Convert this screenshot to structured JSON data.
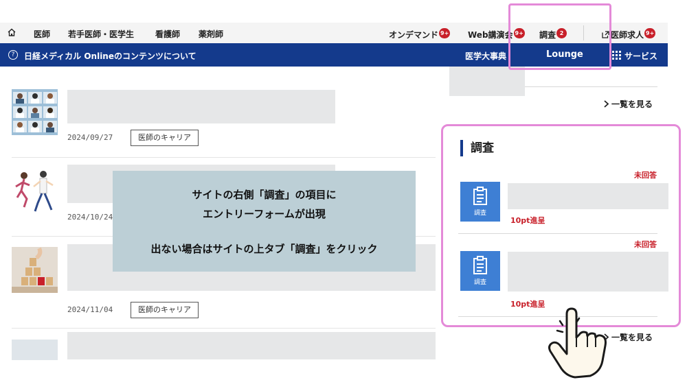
{
  "top_nav": {
    "items": [
      {
        "label": "医師"
      },
      {
        "label": "若手医師・医学生"
      },
      {
        "label": "看護師"
      },
      {
        "label": "薬剤師"
      }
    ],
    "right_items": [
      {
        "label": "オンデマンド",
        "badge": "9+"
      },
      {
        "label": "Web講演会",
        "badge": "9+"
      },
      {
        "label": "調査",
        "badge": "2"
      },
      {
        "label": "医師求人",
        "badge": "9+"
      }
    ]
  },
  "blue_bar": {
    "about_label": "日経メディカル Onlineのコンテンツについて",
    "dictionary_label": "医学大事典",
    "lounge_label": "Lounge",
    "services_label": "サービス"
  },
  "articles": [
    {
      "date": "2024/09/27",
      "tag": "医師のキャリア"
    },
    {
      "date": "2024/10/24",
      "tag": ""
    },
    {
      "date": "2024/11/04",
      "tag": "医師のキャリア"
    },
    {
      "date": "",
      "tag": ""
    }
  ],
  "sidebar": {
    "see_more_label": "一覧を見る",
    "survey": {
      "heading": "調査",
      "icon_label": "調査",
      "items": [
        {
          "status": "未回答",
          "points": "10pt進呈"
        },
        {
          "status": "未回答",
          "points": "10pt進呈"
        }
      ],
      "see_more_label": "一覧を見る"
    }
  },
  "callout": {
    "line1": "サイトの右側「調査」の項目に",
    "line2": "エントリーフォームが出現",
    "line3": "出ない場合はサイトの上タブ「調査」をクリック"
  },
  "colors": {
    "brand_blue": "#143a8c",
    "badge_red": "#c8202a",
    "highlight_pink": "#e48ad8",
    "survey_icon_blue": "#3e7fd4"
  }
}
